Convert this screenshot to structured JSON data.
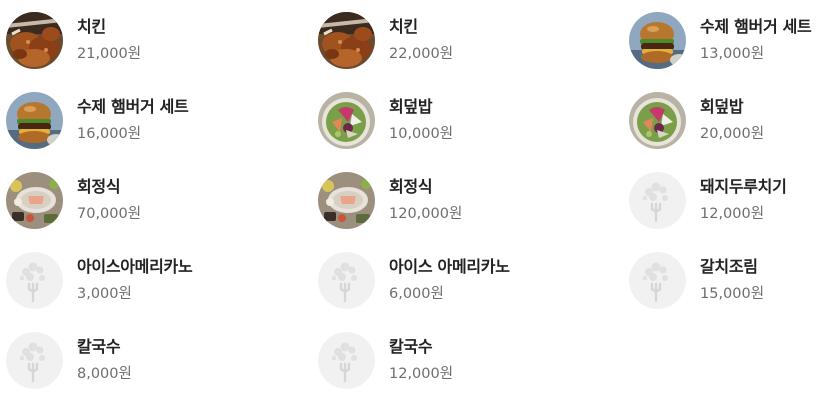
{
  "menu": {
    "items": [
      {
        "name": "치킨",
        "price": "21,000원",
        "image": "chicken"
      },
      {
        "name": "치킨",
        "price": "22,000원",
        "image": "chicken"
      },
      {
        "name": "수제 햄버거 세트",
        "price": "13,000원",
        "image": "burger"
      },
      {
        "name": "수제 햄버거 세트",
        "price": "16,000원",
        "image": "burger"
      },
      {
        "name": "회덮밥",
        "price": "10,000원",
        "image": "bowl"
      },
      {
        "name": "회덮밥",
        "price": "20,000원",
        "image": "bowl"
      },
      {
        "name": "회정식",
        "price": "70,000원",
        "image": "table"
      },
      {
        "name": "회정식",
        "price": "120,000원",
        "image": "table"
      },
      {
        "name": "돼지두루치기",
        "price": "12,000원",
        "image": "placeholder"
      },
      {
        "name": "아이스아메리카노",
        "price": "3,000원",
        "image": "placeholder"
      },
      {
        "name": "아이스 아메리카노",
        "price": "6,000원",
        "image": "placeholder"
      },
      {
        "name": "갈치조림",
        "price": "15,000원",
        "image": "placeholder"
      },
      {
        "name": "칼국수",
        "price": "8,000원",
        "image": "placeholder"
      },
      {
        "name": "칼국수",
        "price": "12,000원",
        "image": "placeholder"
      }
    ]
  }
}
